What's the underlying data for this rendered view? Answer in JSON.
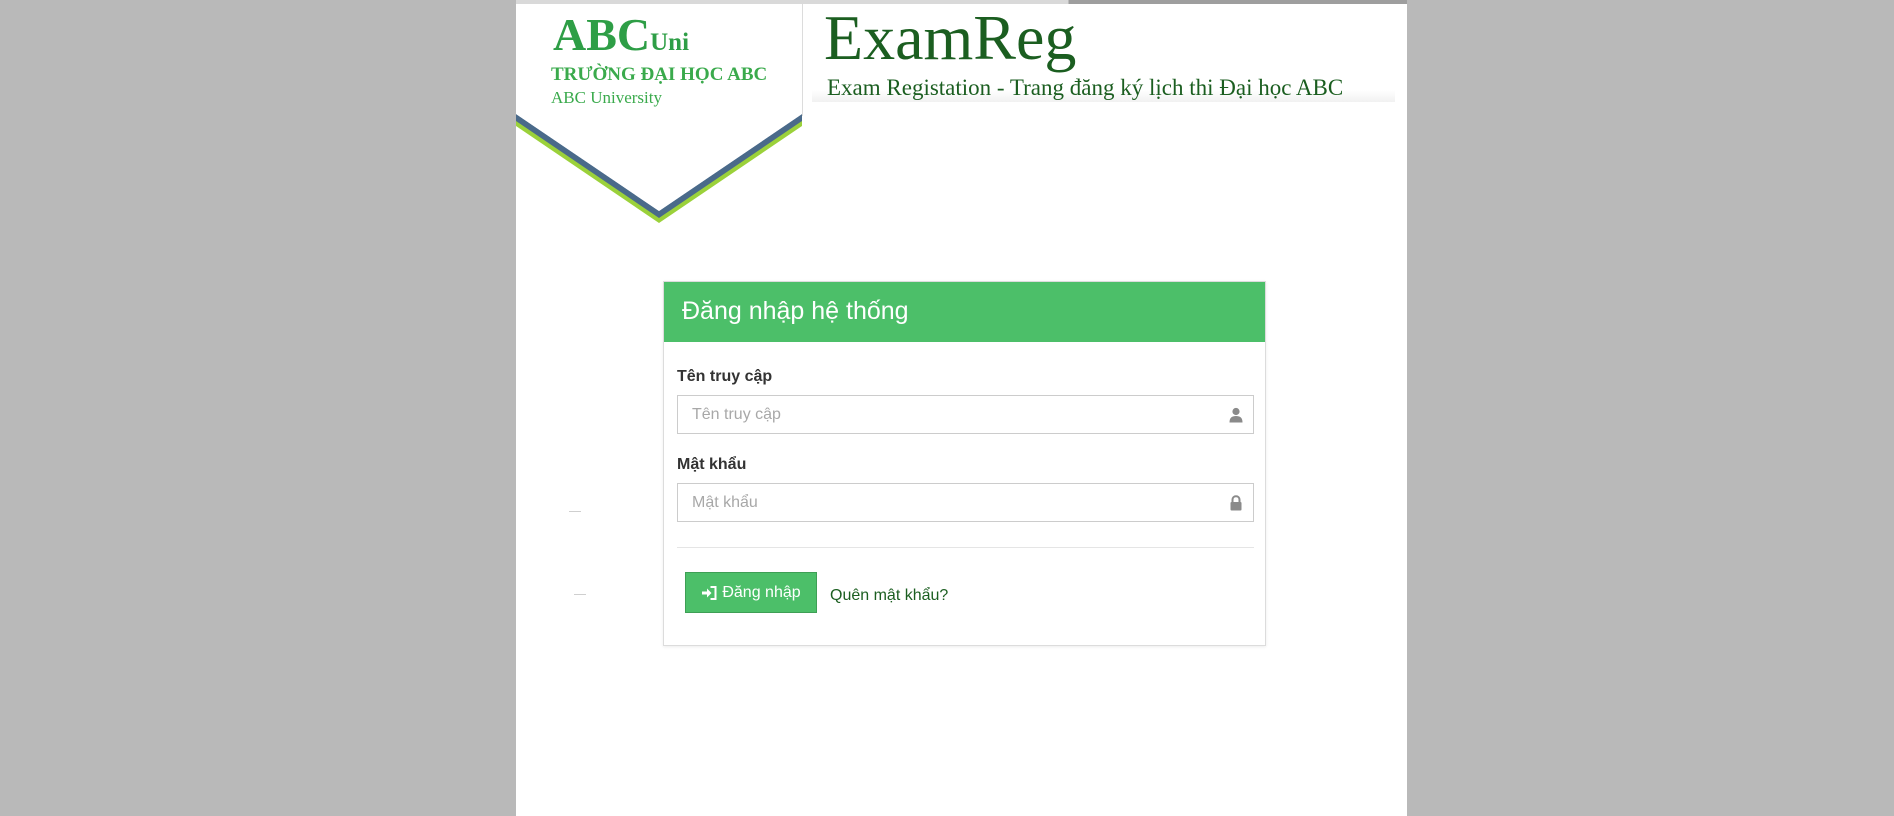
{
  "colors": {
    "background": "#b9b9b9",
    "accent_green": "#4cbf69",
    "dark_green": "#1b5e20",
    "logo_green": "#2e9e46",
    "chevron_blue": "#4a6a8a",
    "chevron_lime": "#9bd13a"
  },
  "logo": {
    "brand": "ABC",
    "brand_suffix": "Uni",
    "school_name": "TRƯỜNG ĐẠI HỌC ABC",
    "english_name": "ABC University"
  },
  "header": {
    "title": "ExamReg",
    "subtitle": "Exam Registation - Trang đăng ký lịch thi Đại học ABC"
  },
  "login": {
    "panel_title": "Đăng nhập hệ thống",
    "username": {
      "label": "Tên truy cập",
      "placeholder": "Tên truy cập",
      "value": "",
      "icon": "user-icon"
    },
    "password": {
      "label": "Mật khẩu",
      "placeholder": "Mật khẩu",
      "value": "",
      "icon": "lock-icon"
    },
    "submit_label": "Đăng nhập",
    "submit_icon": "sign-in-icon",
    "forgot_label": "Quên mật khẩu?"
  }
}
